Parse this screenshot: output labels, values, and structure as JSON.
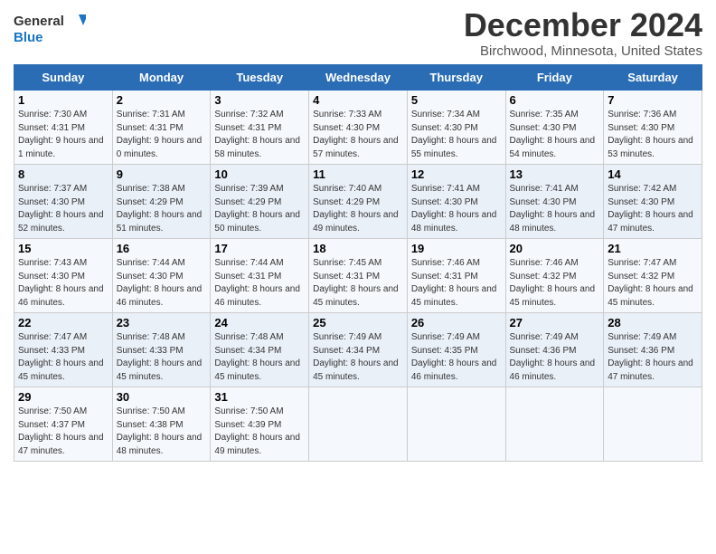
{
  "header": {
    "logo_line1": "General",
    "logo_line2": "Blue",
    "title": "December 2024",
    "subtitle": "Birchwood, Minnesota, United States"
  },
  "days_of_week": [
    "Sunday",
    "Monday",
    "Tuesday",
    "Wednesday",
    "Thursday",
    "Friday",
    "Saturday"
  ],
  "weeks": [
    [
      {
        "day": 1,
        "sunrise": "7:30 AM",
        "sunset": "4:31 PM",
        "daylight": "9 hours and 1 minute."
      },
      {
        "day": 2,
        "sunrise": "7:31 AM",
        "sunset": "4:31 PM",
        "daylight": "9 hours and 0 minutes."
      },
      {
        "day": 3,
        "sunrise": "7:32 AM",
        "sunset": "4:31 PM",
        "daylight": "8 hours and 58 minutes."
      },
      {
        "day": 4,
        "sunrise": "7:33 AM",
        "sunset": "4:30 PM",
        "daylight": "8 hours and 57 minutes."
      },
      {
        "day": 5,
        "sunrise": "7:34 AM",
        "sunset": "4:30 PM",
        "daylight": "8 hours and 55 minutes."
      },
      {
        "day": 6,
        "sunrise": "7:35 AM",
        "sunset": "4:30 PM",
        "daylight": "8 hours and 54 minutes."
      },
      {
        "day": 7,
        "sunrise": "7:36 AM",
        "sunset": "4:30 PM",
        "daylight": "8 hours and 53 minutes."
      }
    ],
    [
      {
        "day": 8,
        "sunrise": "7:37 AM",
        "sunset": "4:30 PM",
        "daylight": "8 hours and 52 minutes."
      },
      {
        "day": 9,
        "sunrise": "7:38 AM",
        "sunset": "4:29 PM",
        "daylight": "8 hours and 51 minutes."
      },
      {
        "day": 10,
        "sunrise": "7:39 AM",
        "sunset": "4:29 PM",
        "daylight": "8 hours and 50 minutes."
      },
      {
        "day": 11,
        "sunrise": "7:40 AM",
        "sunset": "4:29 PM",
        "daylight": "8 hours and 49 minutes."
      },
      {
        "day": 12,
        "sunrise": "7:41 AM",
        "sunset": "4:30 PM",
        "daylight": "8 hours and 48 minutes."
      },
      {
        "day": 13,
        "sunrise": "7:41 AM",
        "sunset": "4:30 PM",
        "daylight": "8 hours and 48 minutes."
      },
      {
        "day": 14,
        "sunrise": "7:42 AM",
        "sunset": "4:30 PM",
        "daylight": "8 hours and 47 minutes."
      }
    ],
    [
      {
        "day": 15,
        "sunrise": "7:43 AM",
        "sunset": "4:30 PM",
        "daylight": "8 hours and 46 minutes."
      },
      {
        "day": 16,
        "sunrise": "7:44 AM",
        "sunset": "4:30 PM",
        "daylight": "8 hours and 46 minutes."
      },
      {
        "day": 17,
        "sunrise": "7:44 AM",
        "sunset": "4:31 PM",
        "daylight": "8 hours and 46 minutes."
      },
      {
        "day": 18,
        "sunrise": "7:45 AM",
        "sunset": "4:31 PM",
        "daylight": "8 hours and 45 minutes."
      },
      {
        "day": 19,
        "sunrise": "7:46 AM",
        "sunset": "4:31 PM",
        "daylight": "8 hours and 45 minutes."
      },
      {
        "day": 20,
        "sunrise": "7:46 AM",
        "sunset": "4:32 PM",
        "daylight": "8 hours and 45 minutes."
      },
      {
        "day": 21,
        "sunrise": "7:47 AM",
        "sunset": "4:32 PM",
        "daylight": "8 hours and 45 minutes."
      }
    ],
    [
      {
        "day": 22,
        "sunrise": "7:47 AM",
        "sunset": "4:33 PM",
        "daylight": "8 hours and 45 minutes."
      },
      {
        "day": 23,
        "sunrise": "7:48 AM",
        "sunset": "4:33 PM",
        "daylight": "8 hours and 45 minutes."
      },
      {
        "day": 24,
        "sunrise": "7:48 AM",
        "sunset": "4:34 PM",
        "daylight": "8 hours and 45 minutes."
      },
      {
        "day": 25,
        "sunrise": "7:49 AM",
        "sunset": "4:34 PM",
        "daylight": "8 hours and 45 minutes."
      },
      {
        "day": 26,
        "sunrise": "7:49 AM",
        "sunset": "4:35 PM",
        "daylight": "8 hours and 46 minutes."
      },
      {
        "day": 27,
        "sunrise": "7:49 AM",
        "sunset": "4:36 PM",
        "daylight": "8 hours and 46 minutes."
      },
      {
        "day": 28,
        "sunrise": "7:49 AM",
        "sunset": "4:36 PM",
        "daylight": "8 hours and 47 minutes."
      }
    ],
    [
      {
        "day": 29,
        "sunrise": "7:50 AM",
        "sunset": "4:37 PM",
        "daylight": "8 hours and 47 minutes."
      },
      {
        "day": 30,
        "sunrise": "7:50 AM",
        "sunset": "4:38 PM",
        "daylight": "8 hours and 48 minutes."
      },
      {
        "day": 31,
        "sunrise": "7:50 AM",
        "sunset": "4:39 PM",
        "daylight": "8 hours and 49 minutes."
      },
      null,
      null,
      null,
      null
    ]
  ]
}
